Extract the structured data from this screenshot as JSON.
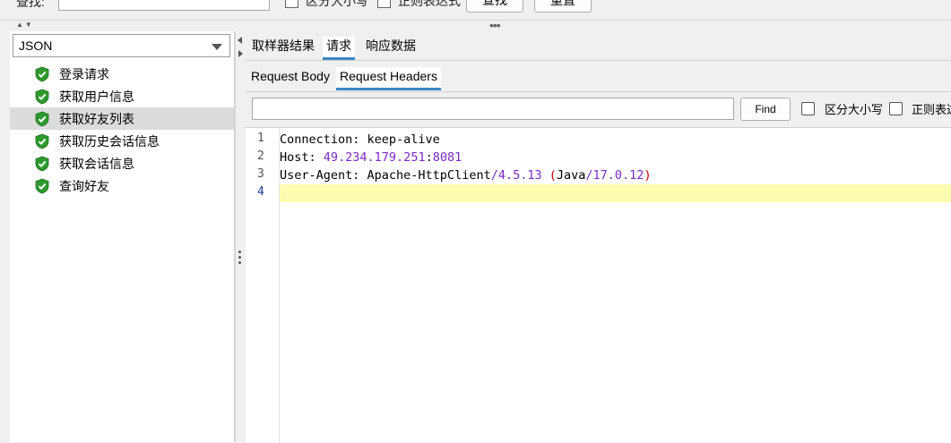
{
  "top": {
    "search_label": "查找:",
    "case_label": "区分大小写",
    "regex_label": "正则表达式",
    "find_button": "查找",
    "reset_button": "重置"
  },
  "left": {
    "format_select": "JSON",
    "tree": [
      {
        "label": "登录请求",
        "status": "success",
        "selected": false
      },
      {
        "label": "获取用户信息",
        "status": "success",
        "selected": false
      },
      {
        "label": "获取好友列表",
        "status": "success",
        "selected": true
      },
      {
        "label": "获取历史会话信息",
        "status": "success",
        "selected": false
      },
      {
        "label": "获取会话信息",
        "status": "success",
        "selected": false
      },
      {
        "label": "查询好友",
        "status": "success",
        "selected": false
      }
    ]
  },
  "right": {
    "tabs": [
      {
        "label": "取样器结果",
        "active": false
      },
      {
        "label": "请求",
        "active": true
      },
      {
        "label": "响应数据",
        "active": false
      }
    ],
    "subtabs": [
      {
        "label": "Request Body",
        "active": false
      },
      {
        "label": "Request Headers",
        "active": true
      }
    ],
    "find": {
      "value": "",
      "button": "Find",
      "case_label": "区分大小写",
      "regex_label": "正则表达"
    },
    "editor": {
      "line_numbers": [
        "1",
        "2",
        "3",
        "4"
      ],
      "current_line": 4,
      "lines": [
        [
          {
            "text": "Connection: keep-alive",
            "cls": "k"
          }
        ],
        [
          {
            "text": "Host: ",
            "cls": "k"
          },
          {
            "text": "49.234.179.251",
            "cls": "p"
          },
          {
            "text": ":",
            "cls": "k"
          },
          {
            "text": "8081",
            "cls": "p"
          }
        ],
        [
          {
            "text": "User-Agent: Apache-HttpClient",
            "cls": "k"
          },
          {
            "text": "/4.5.13",
            "cls": "p"
          },
          {
            "text": " ",
            "cls": "k"
          },
          {
            "text": "(",
            "cls": "r"
          },
          {
            "text": "Java",
            "cls": "k"
          },
          {
            "text": "/17.0.12",
            "cls": "p"
          },
          {
            "text": ")",
            "cls": "r"
          }
        ],
        []
      ]
    }
  },
  "colors": {
    "accent": "#3b86c8",
    "selected_row": "#dcdcdc",
    "current_line": "#fcfcb0",
    "number": "#7a2ac8",
    "paren": "#c00000",
    "success_shield": "#2e9a2e"
  }
}
